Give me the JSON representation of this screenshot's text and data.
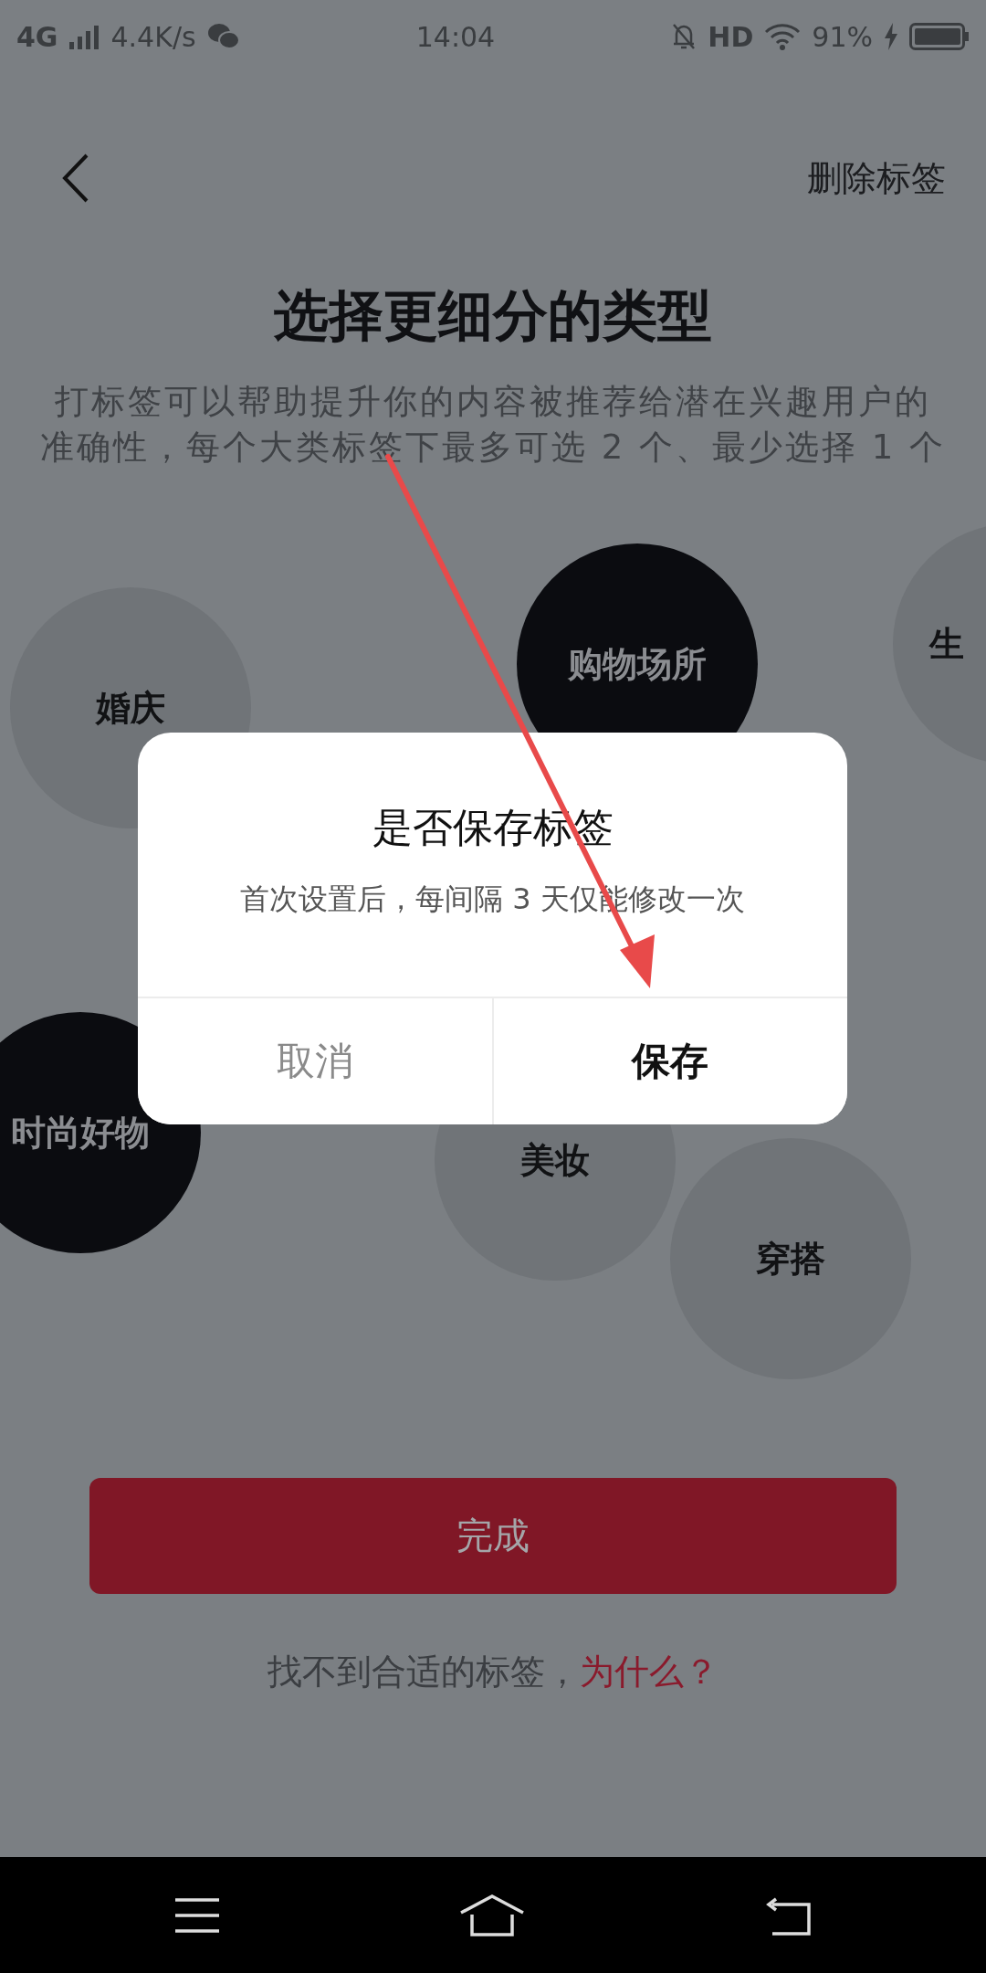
{
  "status_bar": {
    "network": "4G",
    "speed": "4.4K/s",
    "time": "14:04",
    "hd": "HD",
    "battery": "91%"
  },
  "header": {
    "action": "删除标签"
  },
  "title": "选择更细分的类型",
  "description": "打标签可以帮助提升你的内容被推荐给潜在兴趣用户的准确性，每个大类标签下最多可选 2 个、最少选择 1 个",
  "tags": [
    {
      "label": "婚庆",
      "selected": false
    },
    {
      "label": "购物场所",
      "selected": true
    },
    {
      "label": "生",
      "selected": false
    },
    {
      "label": "时尚好物",
      "selected": true
    },
    {
      "label": "美妆",
      "selected": false
    },
    {
      "label": "穿搭",
      "selected": false
    }
  ],
  "done_button": "完成",
  "footer": {
    "text": "找不到合适的标签，",
    "link": "为什么？"
  },
  "dialog": {
    "title": "是否保存标签",
    "message": "首次设置后，每间隔 3 天仅能修改一次",
    "buttons": [
      {
        "label": "取消",
        "kind": "cancel"
      },
      {
        "label": "保存",
        "kind": "confirm"
      }
    ]
  }
}
